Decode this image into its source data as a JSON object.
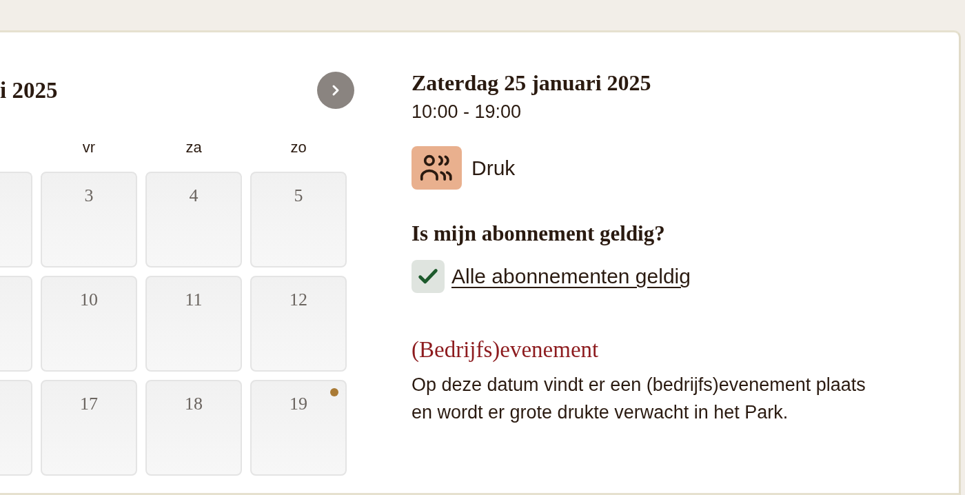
{
  "calendar": {
    "title": "i 2025",
    "weekdays": [
      {
        "kind": "partial"
      },
      {
        "kind": "day",
        "label": "vr"
      },
      {
        "kind": "day",
        "label": "za"
      },
      {
        "kind": "day",
        "label": "zo"
      }
    ],
    "weeks": [
      [
        {
          "kind": "partial"
        },
        {
          "kind": "day",
          "day": "3",
          "marked": false
        },
        {
          "kind": "day",
          "day": "4",
          "marked": false
        },
        {
          "kind": "day",
          "day": "5",
          "marked": false
        }
      ],
      [
        {
          "kind": "partial"
        },
        {
          "kind": "day",
          "day": "10",
          "marked": false
        },
        {
          "kind": "day",
          "day": "11",
          "marked": false
        },
        {
          "kind": "day",
          "day": "12",
          "marked": false
        }
      ],
      [
        {
          "kind": "partial"
        },
        {
          "kind": "day",
          "day": "17",
          "marked": false
        },
        {
          "kind": "day",
          "day": "18",
          "marked": false
        },
        {
          "kind": "day",
          "day": "19",
          "marked": true
        }
      ]
    ]
  },
  "details": {
    "date": "Zaterdag 25 januari 2025",
    "hours": "10:00 - 19:00",
    "crowd": {
      "label": "Druk",
      "color": "#e9b08e"
    },
    "subscription": {
      "heading": "Is mijn abonnement geldig?",
      "checked": true,
      "link": "Alle abonnementen geldig"
    },
    "event": {
      "title": "(Bedrijfs)evenement",
      "text": "Op deze datum vindt er een (bedrijfs)evenement plaats en wordt er grote drukte verwacht in het Park."
    }
  }
}
